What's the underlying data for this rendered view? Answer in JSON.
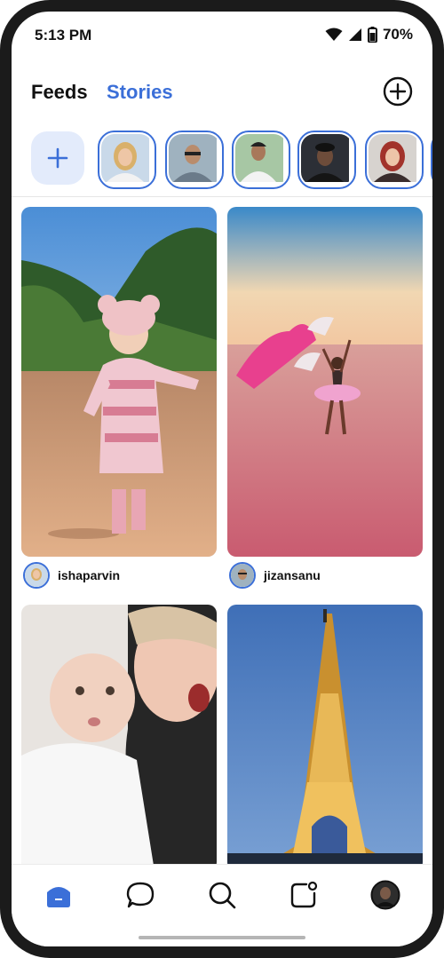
{
  "status_bar": {
    "time": "5:13 PM",
    "battery": "70%"
  },
  "header": {
    "tabs": [
      {
        "label": "Feeds"
      },
      {
        "label": "Stories"
      }
    ],
    "active_tab": "Stories",
    "create_icon": "plus-circle-icon"
  },
  "stories": {
    "add_icon": "plus-icon",
    "items": [
      {
        "user": "story-user-1"
      },
      {
        "user": "story-user-2"
      },
      {
        "user": "story-user-3"
      },
      {
        "user": "story-user-4"
      },
      {
        "user": "story-user-5"
      }
    ]
  },
  "feed": {
    "posts": [
      {
        "author": "ishaparvin",
        "image": "toddler-on-beach"
      },
      {
        "author": "jizansanu",
        "image": "dancer-with-fans"
      },
      {
        "author": "",
        "image": "mother-and-baby"
      },
      {
        "author": "",
        "image": "eiffel-tower-night"
      }
    ]
  },
  "bottom_nav": {
    "items": [
      {
        "icon": "home-icon",
        "active": true
      },
      {
        "icon": "chat-icon",
        "active": false
      },
      {
        "icon": "search-icon",
        "active": false
      },
      {
        "icon": "notification-icon",
        "active": false
      },
      {
        "icon": "profile-avatar",
        "active": false
      }
    ]
  },
  "colors": {
    "accent": "#3b6fd8",
    "accent_light": "#e3ebfb",
    "text": "#111111"
  }
}
